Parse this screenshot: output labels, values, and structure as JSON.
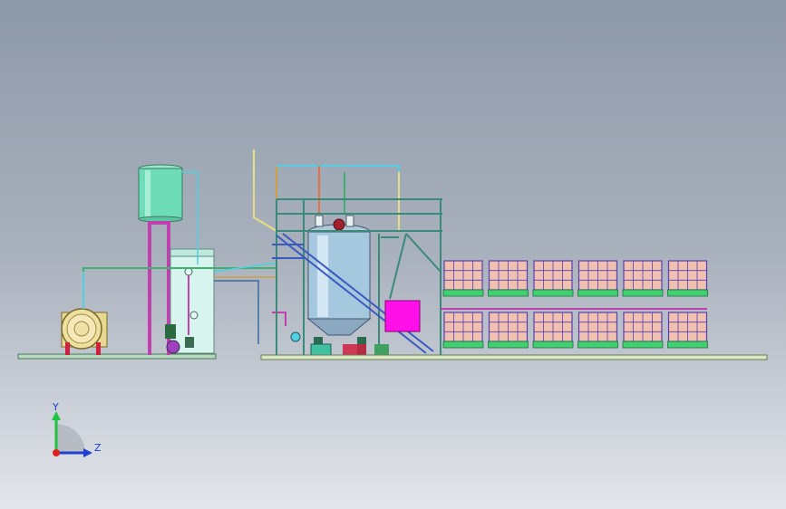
{
  "triad": {
    "y_label": "Y",
    "z_label": "Z"
  },
  "colors": {
    "tank": "#6fdcb8",
    "support": "#c040b0",
    "pipe_cyan": "#50d0e0",
    "pipe_green": "#40b070",
    "base": "#b8d8c0",
    "magenta_box": "#ff10e8",
    "ibc_cage": "#5a3fb0",
    "ibc_fill": "#f0c0b0",
    "ibc_pallet": "#40d070",
    "boiler_red": "#d02040",
    "frame": "#3a8a7a"
  }
}
